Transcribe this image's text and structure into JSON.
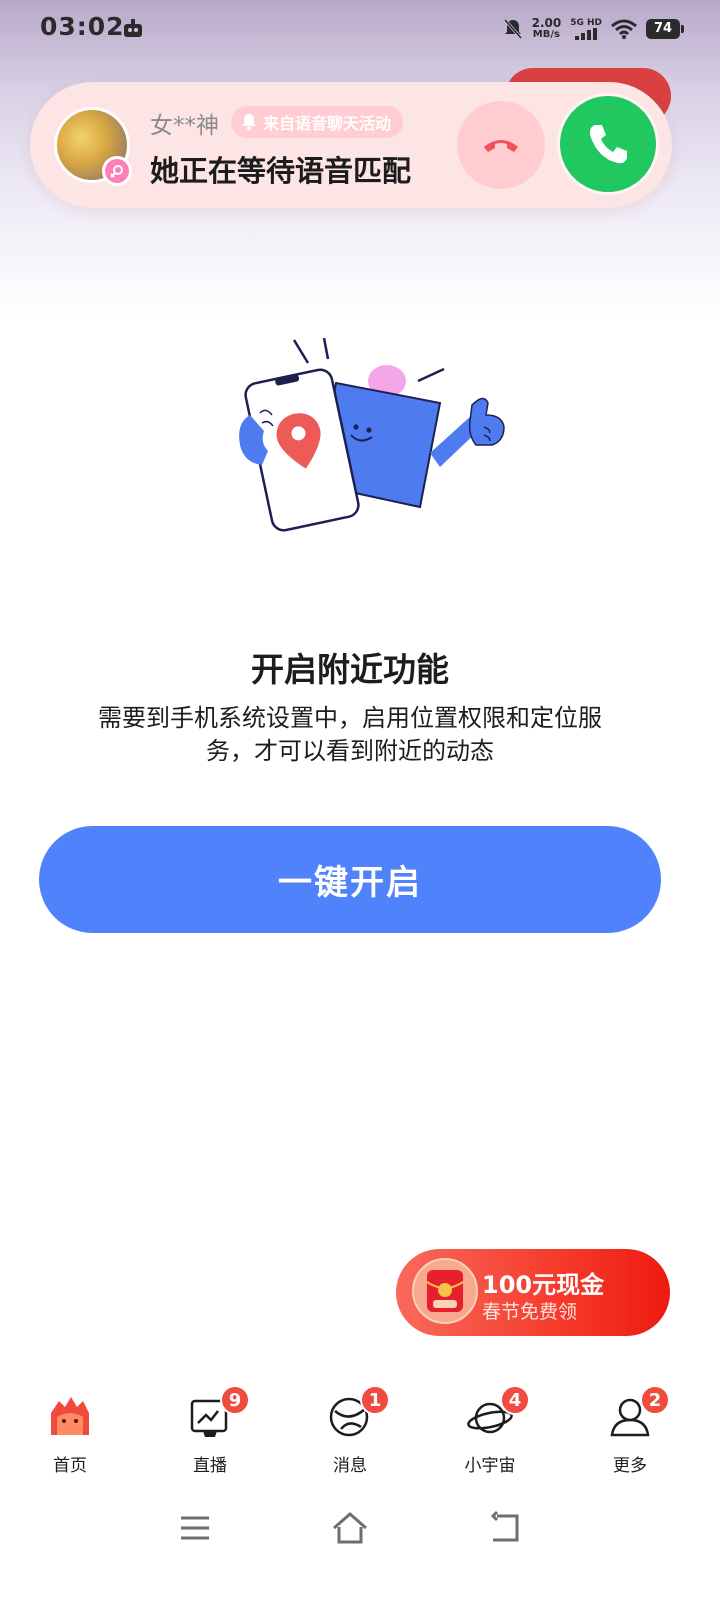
{
  "status_bar": {
    "time": "03:02",
    "net_speed_value": "2.00",
    "net_speed_unit": "MB/s",
    "network_type": "5G HD",
    "battery": "74"
  },
  "call_banner": {
    "caller_name": "女**神",
    "source_tag": "来自语音聊天活动",
    "status": "她正在等待语音匹配"
  },
  "feature": {
    "title": "开启附近功能",
    "description": "需要到手机系统设置中，启用位置权限和定位服务，才可以看到附近的动态",
    "enable_button": "一键开启"
  },
  "promo": {
    "title": "100元现金",
    "subtitle": "春节免费领"
  },
  "bottom_nav": {
    "items": [
      {
        "label": "首页",
        "icon": "home-icon",
        "badge": ""
      },
      {
        "label": "直播",
        "icon": "live-icon",
        "badge": "9"
      },
      {
        "label": "消息",
        "icon": "message-icon",
        "badge": "1"
      },
      {
        "label": "小宇宙",
        "icon": "planet-icon",
        "badge": "4"
      },
      {
        "label": "更多",
        "icon": "more-icon",
        "badge": "2"
      }
    ]
  },
  "colors": {
    "primary_button": "#5083fb",
    "accept": "#21c860",
    "decline": "#ffcdd0",
    "badge": "#f04b3e",
    "promo": "#f53a2b"
  }
}
